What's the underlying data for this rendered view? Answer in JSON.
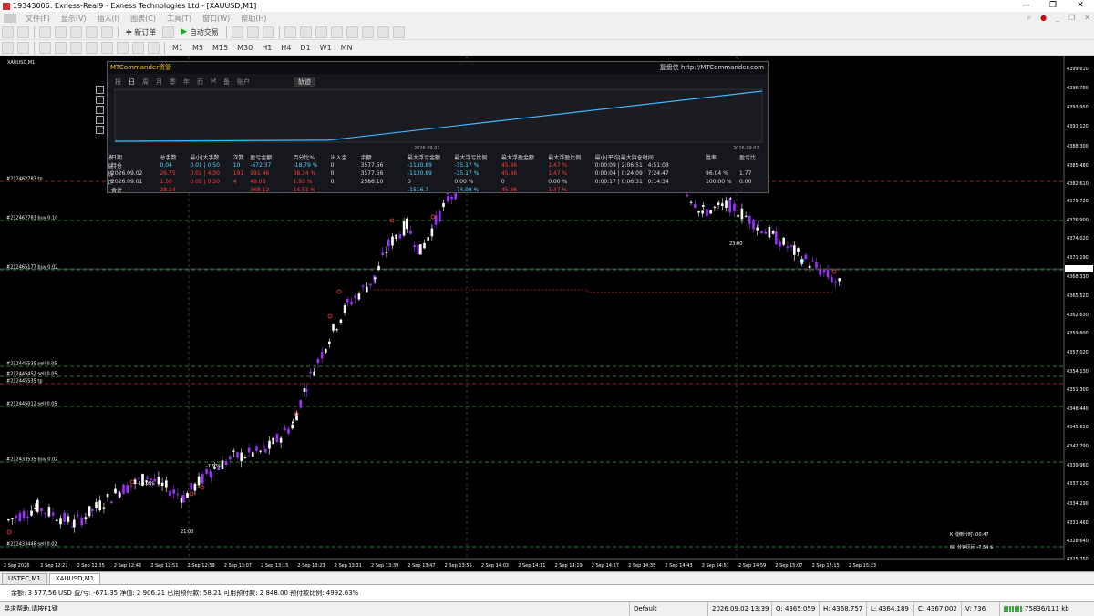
{
  "window": {
    "title": "19343006: Exness-Real9 - Exness Technologies Ltd - [XAUUSD,M1]"
  },
  "menu": {
    "items": [
      "文件(F)",
      "显示(V)",
      "插入(I)",
      "图表(C)",
      "工具(T)",
      "窗口(W)",
      "帮助(H)"
    ]
  },
  "toolbar": {
    "new_order_label": "新订单",
    "auto_trade_label": "自动交易",
    "timeframes": [
      "M1",
      "M5",
      "M15",
      "M30",
      "H1",
      "H4",
      "D1",
      "W1",
      "MN"
    ]
  },
  "chart": {
    "symbol_label": "XAUUSD,M1",
    "price_labels": [
      "4399.610",
      "4396.780",
      "4393.950",
      "4391.120",
      "4388.300",
      "4385.480",
      "4382.610",
      "4379.720",
      "4376.900",
      "4374.020",
      "4371.190",
      "4369.468",
      "4368.330",
      "4365.520",
      "4362.630",
      "4359.800",
      "4357.020",
      "4354.130",
      "4351.300",
      "4348.440",
      "4345.610",
      "4342.790",
      "4339.960",
      "4337.130",
      "4334.290",
      "4331.460",
      "4328.640",
      "4325.750"
    ],
    "current_price": "4369.468",
    "time_labels": [
      "2 Sep 2026",
      "2 Sep 12:27",
      "2 Sep 12:35",
      "2 Sep 12:43",
      "2 Sep 12:51",
      "2 Sep 12:59",
      "2 Sep 13:07",
      "2 Sep 13:15",
      "2 Sep 13:23",
      "2 Sep 13:31",
      "2 Sep 13:39",
      "2 Sep 13:47",
      "2 Sep 13:55",
      "2 Sep 14:03",
      "2 Sep 14:11",
      "2 Sep 14:19",
      "2 Sep 14:27",
      "2 Sep 14:35",
      "2 Sep 14:43",
      "2 Sep 14:51",
      "2 Sep 14:59",
      "2 Sep 15:07",
      "2 Sep 15:15",
      "2 Sep 15:23"
    ],
    "order_lines": [
      {
        "label": "#212462783 tp",
        "color": "#d03030"
      },
      {
        "label": "#212462783 buy 0.10",
        "color": "#3aa84a"
      },
      {
        "label": "#212465177 buy 0.02",
        "color": "#3aa84a"
      },
      {
        "label": "#212445535 sell 0.05",
        "color": "#3aa84a"
      },
      {
        "label": "#212445452 sell 0.05",
        "color": "#3aa84a"
      },
      {
        "label": "#212445535 tp",
        "color": "#d03030"
      },
      {
        "label": "#212445012 sell 0.05",
        "color": "#3aa84a"
      },
      {
        "label": "#212433535 buy 0.02",
        "color": "#3aa84a"
      },
      {
        "label": "#212433446 sell 0.02",
        "color": "#3aa84a"
      }
    ],
    "annotations": {
      "bar_marker_1": "21:00",
      "bar_marker_2": "23:00",
      "profit_1": "-10.08$",
      "profit_2": "-7.93$"
    },
    "countdown": "K 线倒计时: 00:47",
    "interval": "60 分钟区间 -7.54 $"
  },
  "mtc": {
    "title": "MTCommander资管",
    "site": "复盘侠 http://MTCommander.com",
    "tabs": [
      "报",
      "日",
      "周",
      "月",
      "季",
      "年",
      "而",
      "M",
      "备",
      "账户"
    ],
    "selected_tab": "轨迹",
    "axis_dates": [
      "2026.09.01",
      "2026.09.02"
    ],
    "side_label": "收益统计",
    "equity_curve": {
      "x": [
        0,
        0.32,
        0.33,
        1
      ],
      "y": [
        0,
        0.02,
        0.02,
        1
      ]
    },
    "columns": [
      "日期",
      "总手数",
      "最小|大手数",
      "次数",
      "盈亏金额",
      "百分比%",
      "出入金",
      "余额",
      "最大浮亏金额",
      "最大浮亏比例",
      "最大浮盈金额",
      "最大浮盈比例",
      "最小|平均|最大持仓时间",
      "胜率",
      "盈亏比"
    ],
    "rows": [
      {
        "date": "持仓",
        "lots": "0.04",
        "minmax": "0.01 | 0.50",
        "count": "10",
        "pnl": "-672.37",
        "pct": "-18.79 %",
        "io": "0",
        "balance": "3577.56",
        "maxloss": "-1130.89",
        "maxlosspct": "-35.17 %",
        "maxprofit": "45.86",
        "maxprofitpct": "1.47 %",
        "hold": "0:00:09 | 2:06:51 | 4:51:08",
        "win": "",
        "ratio": ""
      },
      {
        "date": "2026.09.02",
        "lots": "26.75",
        "minmax": "0.01 | 4.00",
        "count": "191",
        "pnl": "991.46",
        "pct": "38.34 %",
        "io": "0",
        "balance": "3577.56",
        "maxloss": "-1130.89",
        "maxlosspct": "-35.17 %",
        "maxprofit": "45.86",
        "maxprofitpct": "1.47 %",
        "hold": "0:00:04 | 0:24:09 | 7:24:47",
        "win": "96.04 %",
        "ratio": "1.77"
      },
      {
        "date": "2026.09.01",
        "lots": "1.50",
        "minmax": "0.05 | 0.50",
        "count": "4",
        "pnl": "49.03",
        "pct": "1.93 %",
        "io": "0",
        "balance": "2586.10",
        "maxloss": "0",
        "maxlosspct": "0.00 %",
        "maxprofit": "0",
        "maxprofitpct": "0.00 %",
        "hold": "0:00:17 | 0:06:31 | 0:14:34",
        "win": "100.00 %",
        "ratio": "0.00"
      },
      {
        "date": "合计",
        "lots": "28.14",
        "minmax": "",
        "count": "",
        "pnl": "368.12",
        "pct": "14.51 %",
        "io": "",
        "balance": "",
        "maxloss": "-1516.7",
        "maxlosspct": "-74.98 %",
        "maxprofit": "45.86",
        "maxprofitpct": "1.47 %",
        "hold": "",
        "win": "",
        "ratio": ""
      }
    ]
  },
  "tabs_bottom": [
    "USTEC,M1",
    "XAUUSD,M1"
  ],
  "account_bar": {
    "text": "余额: 3 577.56 USD  盈/亏: -671.35  净值: 2 906.21  已用预付款: 58.21  可用预付款: 2 848.00  预付款比例: 4992.63%"
  },
  "status": {
    "help": "寻求帮助,请按F1键",
    "profile": "Default",
    "datetime": "2026.09.02 13:39",
    "open": "O: 4365.059",
    "high": "H: 4368.757",
    "low": "L: 4364.189",
    "close": "C: 4367.002",
    "volume": "V: 736",
    "traffic": "75836/111 kb"
  },
  "colors": {
    "bull": "#ffffff",
    "bear": "#9b30ff",
    "accent_cyan": "#3fb6ff",
    "loss_red": "#ff3b3b"
  }
}
